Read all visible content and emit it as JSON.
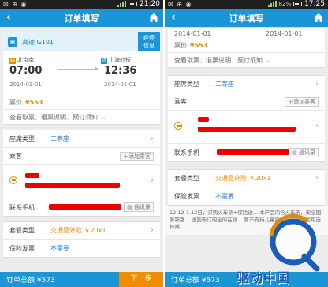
{
  "status_left": {
    "icons_text": "✉ ⊕ ◉",
    "time": "21:20",
    "battery_pct": ""
  },
  "status_right": {
    "icons_text": "✉ ⊕ ◉",
    "time": "17:25",
    "battery_pct": "82%"
  },
  "nav": {
    "title": "订单填写",
    "back_glyph": "‹"
  },
  "train": {
    "type_number": "高速  G101",
    "stop_button": "经停\n信息",
    "from_station": "北京南",
    "to_station": "上海虹桥",
    "from_badge": "始",
    "to_badge": "终",
    "depart_time": "07:00",
    "arrive_time": "12:36",
    "depart_date": "2014-01-01",
    "arrive_date": "2014-01-01"
  },
  "ticket": {
    "price_label": "票价",
    "price": "¥553",
    "info_link": "查看取票、退票说明、预订须知"
  },
  "form": {
    "seat_label": "座席类型",
    "seat_value": "二等座",
    "passenger_label": "乘客",
    "add_passenger": "添加乘客",
    "phone_label": "联系手机",
    "contacts_button": "通讯录",
    "package_label": "套餐类型",
    "package_value": "交通意外险  ￥20x1",
    "insurance_label": "保险发票",
    "insurance_value": "不需要"
  },
  "notice": "12.12-1.12日，订购火车票+保险送... 本产品内含火车票，安全国务铁路... 送到新订购全的在线... 暂不支持儿童票，不购买保险可选择乘...",
  "bottom": {
    "total_label_left": "订单总额 ¥573",
    "next_button": "下一步",
    "total_label_right": "订单总额 ¥573"
  },
  "watermark_text": "驱动中国",
  "colors": {
    "nav_blue": "#1a96d7",
    "price_orange": "#e58b00",
    "next_orange": "#f08c00",
    "redaction_red": "#e00000"
  }
}
